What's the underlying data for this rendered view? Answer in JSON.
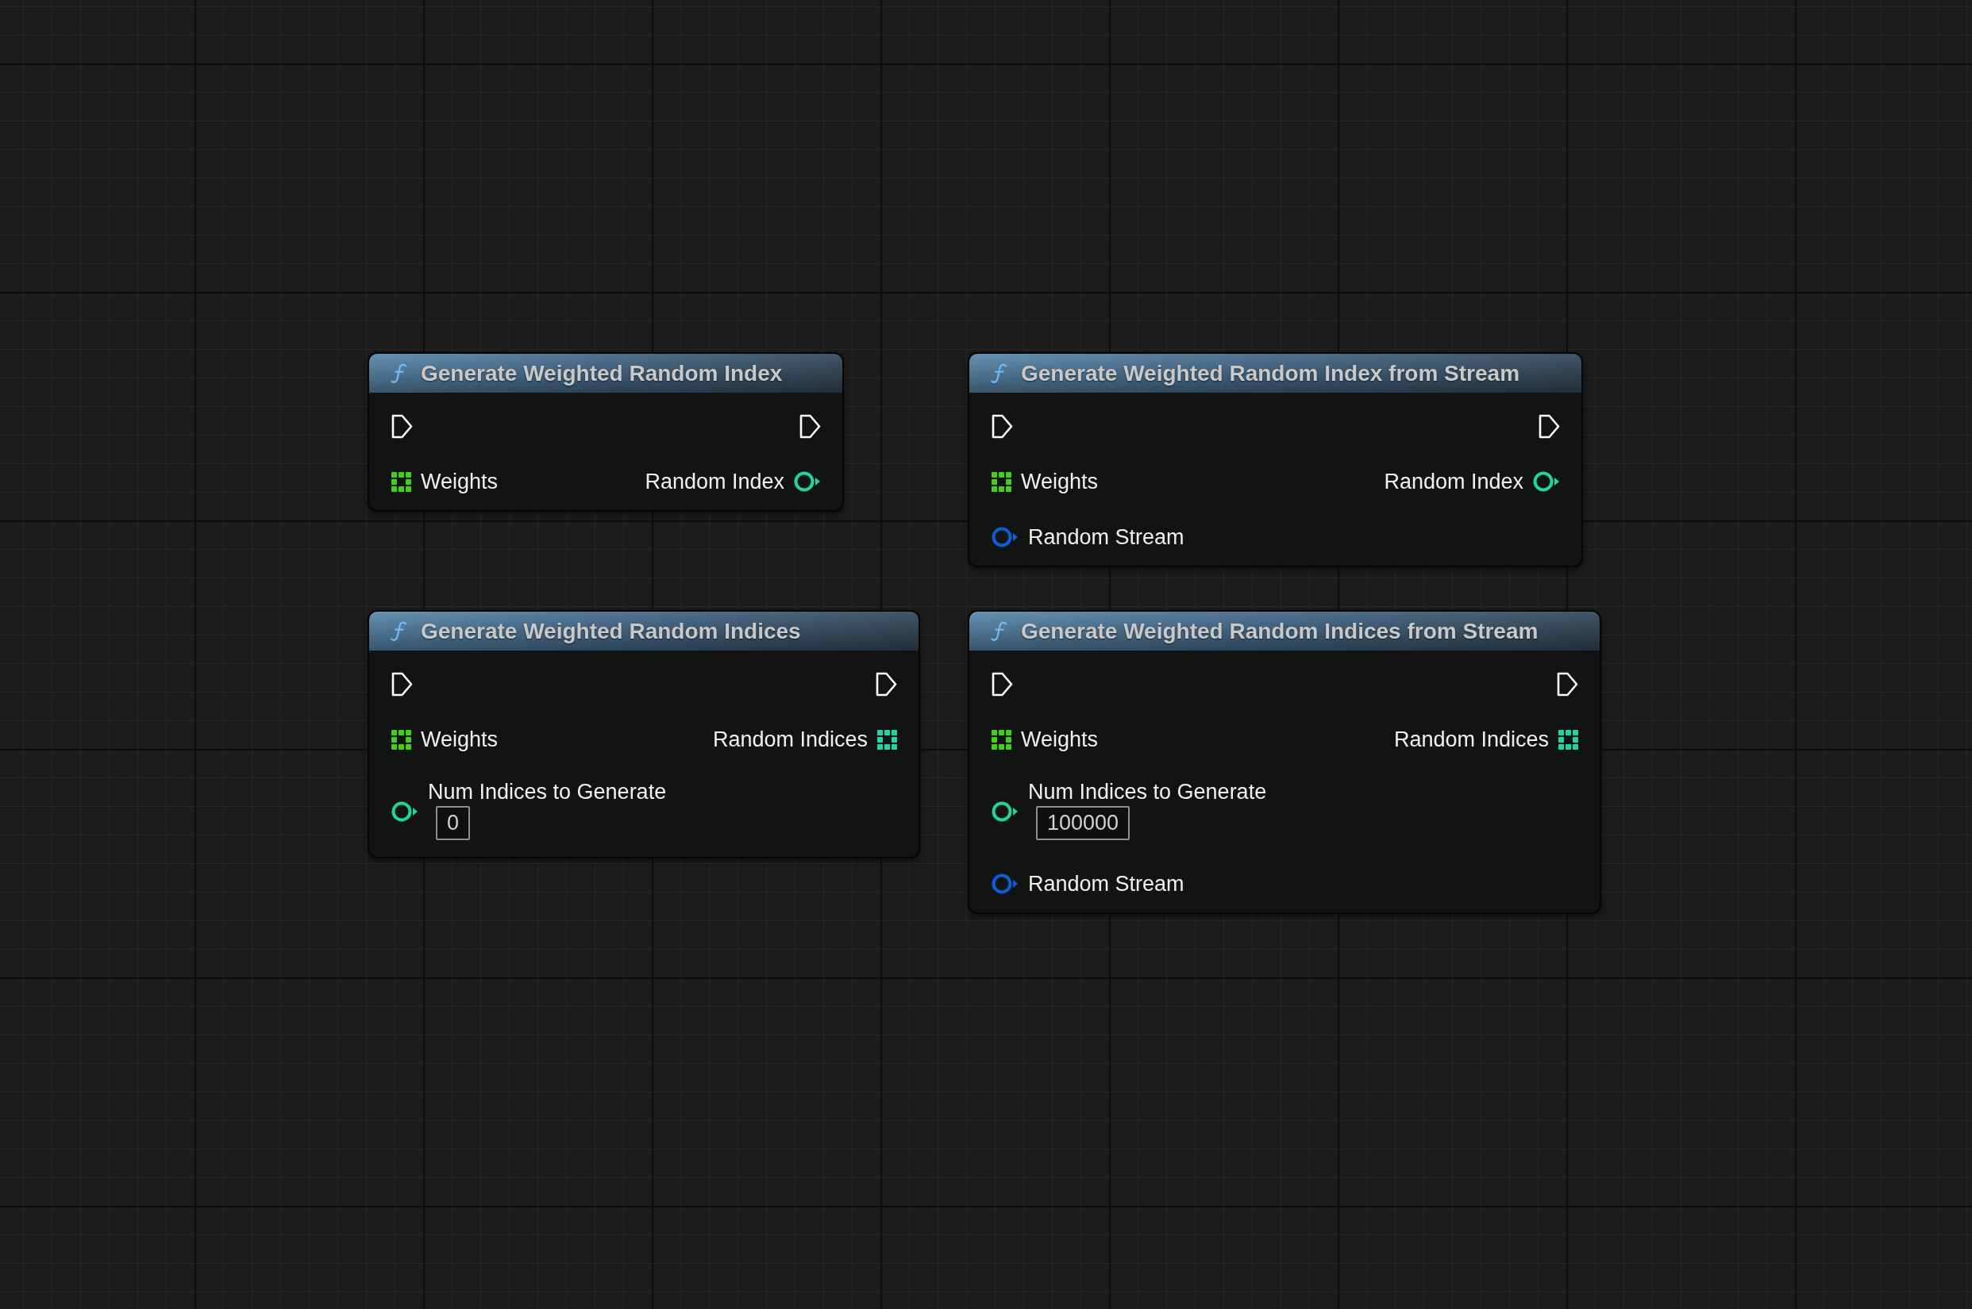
{
  "nodes": [
    {
      "title": "Generate Weighted Random Index",
      "inputs": [
        {
          "kind": "exec",
          "color": "#ffffff"
        },
        {
          "kind": "array",
          "label": "Weights",
          "color": "#3fd214"
        }
      ],
      "outputs": [
        {
          "kind": "exec",
          "color": "#ffffff"
        },
        {
          "kind": "single",
          "label": "Random Index",
          "color": "#1fd6a0"
        }
      ]
    },
    {
      "title": "Generate Weighted Random Index from Stream",
      "inputs": [
        {
          "kind": "exec",
          "color": "#ffffff"
        },
        {
          "kind": "array",
          "label": "Weights",
          "color": "#3fd214"
        },
        {
          "kind": "single",
          "label": "Random Stream",
          "color": "#0b5fd8"
        }
      ],
      "outputs": [
        {
          "kind": "exec",
          "color": "#ffffff"
        },
        {
          "kind": "single",
          "label": "Random Index",
          "color": "#1fd6a0"
        }
      ]
    },
    {
      "title": "Generate Weighted Random Indices",
      "inputs": [
        {
          "kind": "exec",
          "color": "#ffffff"
        },
        {
          "kind": "array",
          "label": "Weights",
          "color": "#3fd214"
        },
        {
          "kind": "single",
          "label": "Num Indices to Generate",
          "color": "#1fd6a0",
          "value": "0"
        }
      ],
      "outputs": [
        {
          "kind": "exec",
          "color": "#ffffff"
        },
        {
          "kind": "array",
          "label": "Random Indices",
          "color": "#1fd6a0"
        }
      ]
    },
    {
      "title": "Generate Weighted Random Indices from Stream",
      "inputs": [
        {
          "kind": "exec",
          "color": "#ffffff"
        },
        {
          "kind": "array",
          "label": "Weights",
          "color": "#3fd214"
        },
        {
          "kind": "single",
          "label": "Num Indices to Generate",
          "color": "#1fd6a0",
          "value": "100000"
        },
        {
          "kind": "single",
          "label": "Random Stream",
          "color": "#0b5fd8"
        }
      ],
      "outputs": [
        {
          "kind": "exec",
          "color": "#ffffff"
        },
        {
          "kind": "array",
          "label": "Random Indices",
          "color": "#1fd6a0"
        }
      ]
    }
  ]
}
